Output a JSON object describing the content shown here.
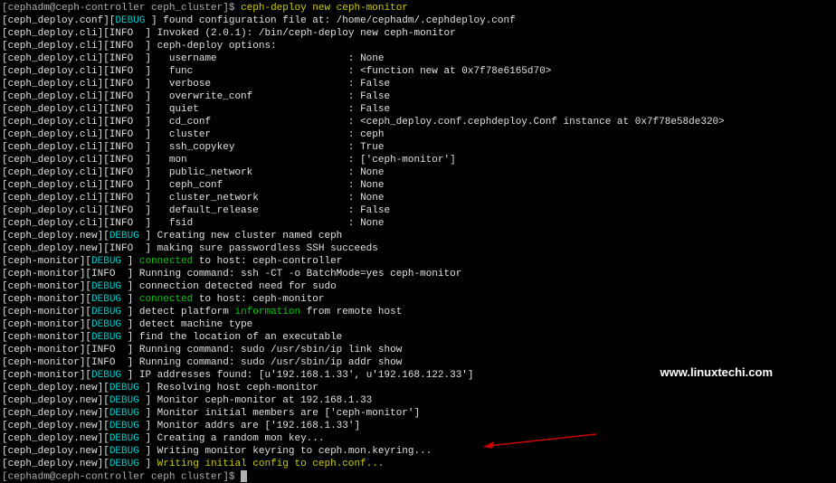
{
  "prompt1": "[cephadm@ceph-controller ceph_cluster]$",
  "command1": "ceph-deploy new ceph-monitor",
  "prompt2": "[cephadm@ceph-controller ceph cluster]$",
  "watermark": "www.linuxtechi.com",
  "lines": [
    {
      "type": "conf",
      "prefix": "[ceph_deploy.conf][",
      "level": "DEBUG",
      "text": " ] found configuration file at: /home/cephadm/.cephdeploy.conf"
    },
    {
      "type": "cli",
      "prefix": "[ceph_deploy.cli][",
      "level": "INFO",
      "text": "  ] Invoked (2.0.1): /bin/ceph-deploy new ceph-monitor"
    },
    {
      "type": "cli",
      "prefix": "[ceph_deploy.cli][",
      "level": "INFO",
      "text": "  ] ceph-deploy options:"
    },
    {
      "type": "cli",
      "prefix": "[ceph_deploy.cli][",
      "level": "INFO",
      "text": "  ]   username                      : None"
    },
    {
      "type": "cli",
      "prefix": "[ceph_deploy.cli][",
      "level": "INFO",
      "text": "  ]   func                          : <function new at 0x7f78e6165d70>"
    },
    {
      "type": "cli",
      "prefix": "[ceph_deploy.cli][",
      "level": "INFO",
      "text": "  ]   verbose                       : False"
    },
    {
      "type": "cli",
      "prefix": "[ceph_deploy.cli][",
      "level": "INFO",
      "text": "  ]   overwrite_conf                : False"
    },
    {
      "type": "cli",
      "prefix": "[ceph_deploy.cli][",
      "level": "INFO",
      "text": "  ]   quiet                         : False"
    },
    {
      "type": "cli",
      "prefix": "[ceph_deploy.cli][",
      "level": "INFO",
      "text": "  ]   cd_conf                       : <ceph_deploy.conf.cephdeploy.Conf instance at 0x7f78e58de320>"
    },
    {
      "type": "cli",
      "prefix": "[ceph_deploy.cli][",
      "level": "INFO",
      "text": "  ]   cluster                       : ceph"
    },
    {
      "type": "cli",
      "prefix": "[ceph_deploy.cli][",
      "level": "INFO",
      "text": "  ]   ssh_copykey                   : True"
    },
    {
      "type": "cli",
      "prefix": "[ceph_deploy.cli][",
      "level": "INFO",
      "text": "  ]   mon                           : ['ceph-monitor']"
    },
    {
      "type": "cli",
      "prefix": "[ceph_deploy.cli][",
      "level": "INFO",
      "text": "  ]   public_network                : None"
    },
    {
      "type": "cli",
      "prefix": "[ceph_deploy.cli][",
      "level": "INFO",
      "text": "  ]   ceph_conf                     : None"
    },
    {
      "type": "cli",
      "prefix": "[ceph_deploy.cli][",
      "level": "INFO",
      "text": "  ]   cluster_network               : None"
    },
    {
      "type": "cli",
      "prefix": "[ceph_deploy.cli][",
      "level": "INFO",
      "text": "  ]   default_release               : False"
    },
    {
      "type": "cli",
      "prefix": "[ceph_deploy.cli][",
      "level": "INFO",
      "text": "  ]   fsid                          : None"
    },
    {
      "type": "new",
      "prefix": "[ceph_deploy.new][",
      "level": "DEBUG",
      "text": " ] Creating new cluster named ceph"
    },
    {
      "type": "new",
      "prefix": "[ceph_deploy.new][",
      "level": "INFO",
      "text": "  ] making sure passwordless SSH succeeds"
    },
    {
      "type": "mon",
      "prefix": "[ceph-monitor][",
      "level": "DEBUG",
      "green1": "connected",
      "text": " to host: ceph-controller"
    },
    {
      "type": "mon",
      "prefix": "[ceph-monitor][",
      "level": "INFO",
      "text": "  ] Running command: ssh -CT -o BatchMode=yes ceph-monitor"
    },
    {
      "type": "mon",
      "prefix": "[ceph-monitor][",
      "level": "DEBUG",
      "text": " ] connection detected need for sudo"
    },
    {
      "type": "mon",
      "prefix": "[ceph-monitor][",
      "level": "DEBUG",
      "green1": "connected",
      "text": " to host: ceph-monitor"
    },
    {
      "type": "mon",
      "prefix": "[ceph-monitor][",
      "level": "DEBUG",
      "pretext": " ] detect platform ",
      "green1": "information",
      "text": " from remote host"
    },
    {
      "type": "mon",
      "prefix": "[ceph-monitor][",
      "level": "DEBUG",
      "text": " ] detect machine type"
    },
    {
      "type": "mon",
      "prefix": "[ceph-monitor][",
      "level": "DEBUG",
      "text": " ] find the location of an executable"
    },
    {
      "type": "mon",
      "prefix": "[ceph-monitor][",
      "level": "INFO",
      "text": "  ] Running command: sudo /usr/sbin/ip link show"
    },
    {
      "type": "mon",
      "prefix": "[ceph-monitor][",
      "level": "INFO",
      "text": "  ] Running command: sudo /usr/sbin/ip addr show"
    },
    {
      "type": "mon",
      "prefix": "[ceph-monitor][",
      "level": "DEBUG",
      "text": " ] IP addresses found: [u'192.168.1.33', u'192.168.122.33']"
    },
    {
      "type": "new",
      "prefix": "[ceph_deploy.new][",
      "level": "DEBUG",
      "text": " ] Resolving host ceph-monitor"
    },
    {
      "type": "new",
      "prefix": "[ceph_deploy.new][",
      "level": "DEBUG",
      "text": " ] Monitor ceph-monitor at 192.168.1.33"
    },
    {
      "type": "new",
      "prefix": "[ceph_deploy.new][",
      "level": "DEBUG",
      "text": " ] Monitor initial members are ['ceph-monitor']"
    },
    {
      "type": "new",
      "prefix": "[ceph_deploy.new][",
      "level": "DEBUG",
      "text": " ] Monitor addrs are ['192.168.1.33']"
    },
    {
      "type": "new",
      "prefix": "[ceph_deploy.new][",
      "level": "DEBUG",
      "text": " ] Creating a random mon key..."
    },
    {
      "type": "new",
      "prefix": "[ceph_deploy.new][",
      "level": "DEBUG",
      "text": " ] Writing monitor keyring to ceph.mon.keyring..."
    },
    {
      "type": "newfinal",
      "prefix": "[ceph_deploy.new][",
      "level": "DEBUG",
      "yellow": "Writing initial config to ceph.conf..."
    }
  ]
}
